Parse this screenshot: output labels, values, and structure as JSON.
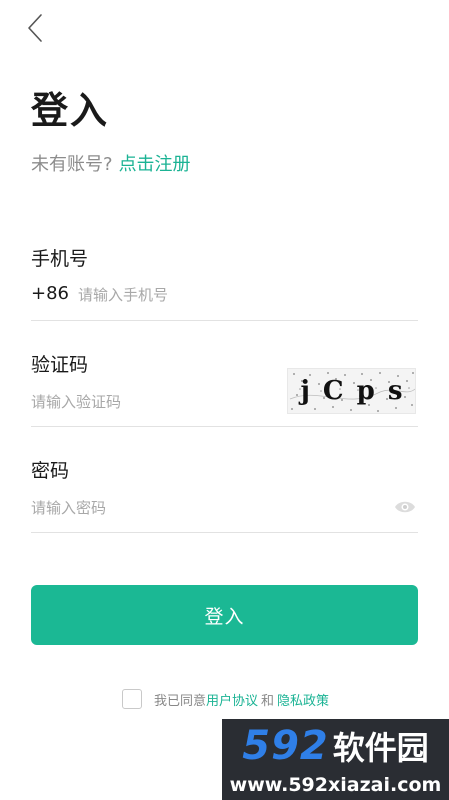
{
  "header": {
    "back_icon": "chevron-left-icon",
    "title": "登入"
  },
  "signup": {
    "prompt": "未有账号?",
    "link": "点击注册"
  },
  "phone": {
    "label": "手机号",
    "prefix": "+86",
    "placeholder": "请输入手机号",
    "value": ""
  },
  "verify": {
    "label": "验证码",
    "placeholder": "请输入验证码",
    "value": "",
    "captcha_chars": [
      "j",
      "C",
      "p",
      "s"
    ]
  },
  "password": {
    "label": "密码",
    "placeholder": "请输入密码",
    "value": "",
    "toggle_icon": "eye-icon"
  },
  "login_button": "登入",
  "agreement": {
    "prefix": "我已同意",
    "user_agreement": "用户协议",
    "and": "和",
    "privacy_policy": "隐私政策",
    "checked": false
  },
  "watermark": {
    "brand_num": "592",
    "brand_cn": "软件园",
    "url": "www.592xiazai.com"
  },
  "colors": {
    "accent": "#1bb894",
    "link": "#1bb394",
    "divider": "#e2e2e2",
    "placeholder": "#a8a8a8",
    "watermark_bg": "#2a2d33",
    "watermark_num": "#2f7fe8"
  }
}
